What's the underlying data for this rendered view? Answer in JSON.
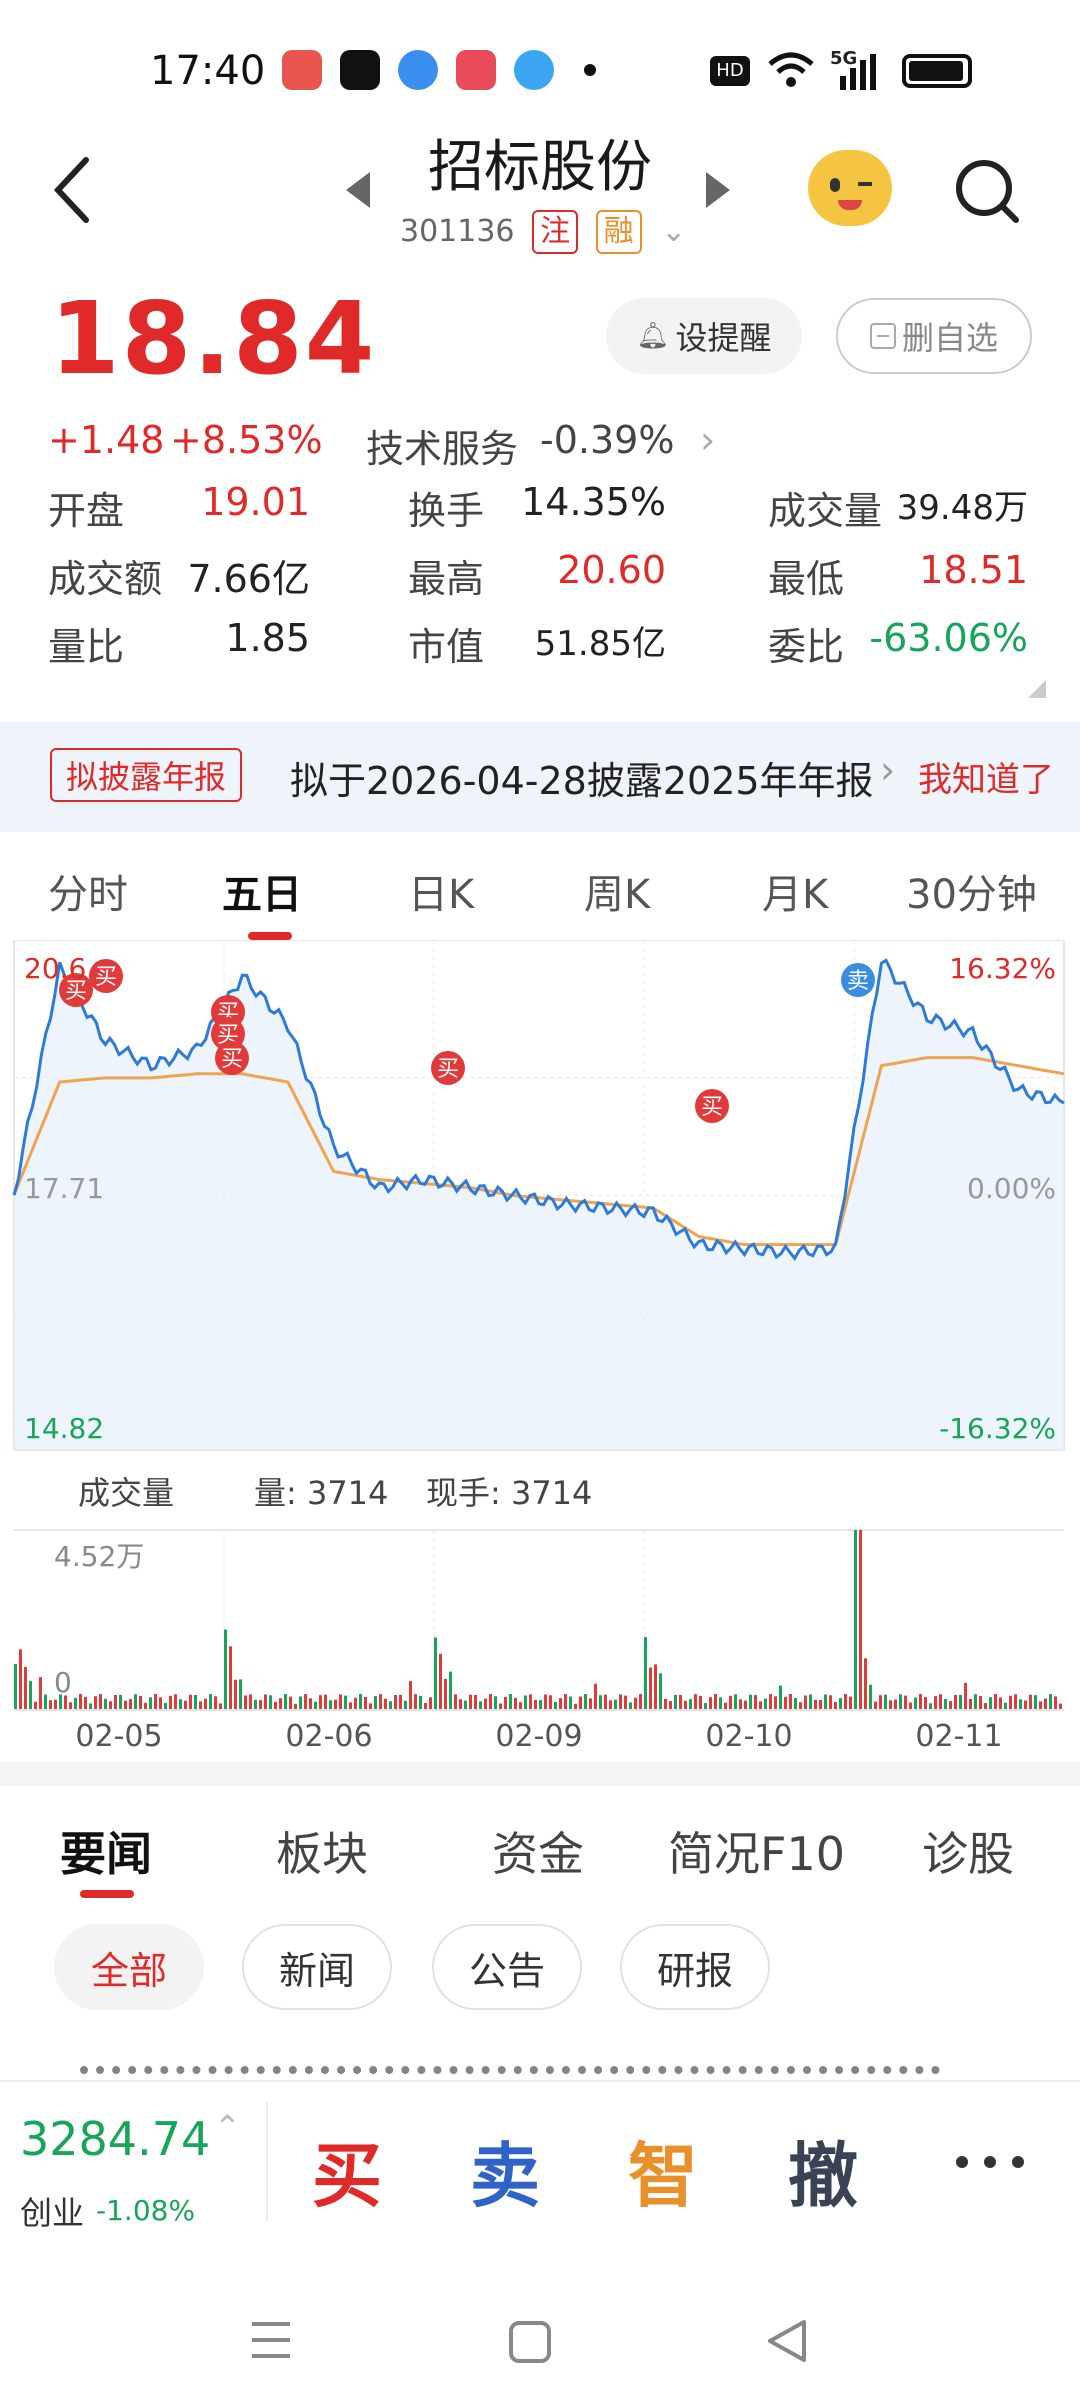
{
  "status_bar": {
    "time": "17:40",
    "network": "5G"
  },
  "header": {
    "title": "招标股份",
    "code": "301136",
    "tag1": "注",
    "tag2": "融"
  },
  "quote": {
    "price": "18.84",
    "change": "+1.48",
    "change_pct": "+8.53%",
    "sector": "技术服务",
    "sector_pct": "-0.39%",
    "alert_label": "设提醒",
    "remove_label": "删自选"
  },
  "stats": [
    [
      {
        "label": "开盘",
        "value": "19.01",
        "color": "red"
      },
      {
        "label": "换手",
        "value": "14.35%",
        "color": "dark"
      },
      {
        "label": "成交量",
        "value": "39.48万",
        "color": "dark"
      }
    ],
    [
      {
        "label": "成交额",
        "value": "7.66亿",
        "color": "dark"
      },
      {
        "label": "最高",
        "value": "20.60",
        "color": "red"
      },
      {
        "label": "最低",
        "value": "18.51",
        "color": "red"
      }
    ],
    [
      {
        "label": "量比",
        "value": "1.85",
        "color": "dark"
      },
      {
        "label": "市值",
        "value": "51.85亿",
        "color": "dark"
      },
      {
        "label": "委比",
        "value": "-63.06%",
        "color": "green"
      }
    ]
  ],
  "notice": {
    "tag": "拟披露年报",
    "text": "拟于2026-04-28披露2025年年报",
    "action": "我知道了"
  },
  "chart_tabs": [
    "分时",
    "五日",
    "日K",
    "周K",
    "月K",
    "30分钟"
  ],
  "chart_tabs_active": 1,
  "chart": {
    "price_high_label": "20.6",
    "price_mid_label": "17.71",
    "price_low_label": "14.82",
    "pct_high_label": "16.32%",
    "pct_mid_label": "0.00%",
    "pct_low_label": "-16.32%",
    "buy_marker": "买",
    "sell_marker": "卖",
    "volume_title": "成交量",
    "volume_label": "量: 3714",
    "current_hand_label": "现手: 3714",
    "vol_max_label": "4.52万",
    "vol_zero_label": "0",
    "dates": [
      "02-05",
      "02-06",
      "02-09",
      "02-10",
      "02-11"
    ]
  },
  "chart_data": {
    "type": "line",
    "title": "",
    "x": [
      "02-05",
      "02-06",
      "02-09",
      "02-10",
      "02-11"
    ],
    "ylim": [
      14.82,
      20.6
    ],
    "reference_price": 17.71,
    "series": [
      {
        "values": [
          17.71,
          20.5,
          19.6,
          19.3,
          19.5,
          20.4,
          19.8,
          18.3,
          17.8,
          17.9,
          17.8,
          17.7,
          17.6,
          17.55,
          17.5,
          17.1,
          17.05,
          17.0,
          17.05,
          20.6,
          19.9,
          19.7,
          19.0,
          18.84
        ]
      },
      {
        "values": [
          17.71,
          19.1,
          19.15,
          19.15,
          19.2,
          19.2,
          19.1,
          18.0,
          17.9,
          17.85,
          17.8,
          17.7,
          17.65,
          17.6,
          17.55,
          17.2,
          17.1,
          17.1,
          17.1,
          19.3,
          19.4,
          19.4,
          19.3,
          19.2
        ]
      }
    ]
  },
  "news_tabs": [
    "要闻",
    "板块",
    "资金",
    "简况F10",
    "诊股"
  ],
  "news_tabs_active": 0,
  "chips": [
    "全部",
    "新闻",
    "公告",
    "研报"
  ],
  "chips_active": 0,
  "index": {
    "value": "3284.74",
    "name": "创业",
    "pct": "-1.08%"
  },
  "trade_buttons": [
    "买",
    "卖",
    "智",
    "撤"
  ]
}
